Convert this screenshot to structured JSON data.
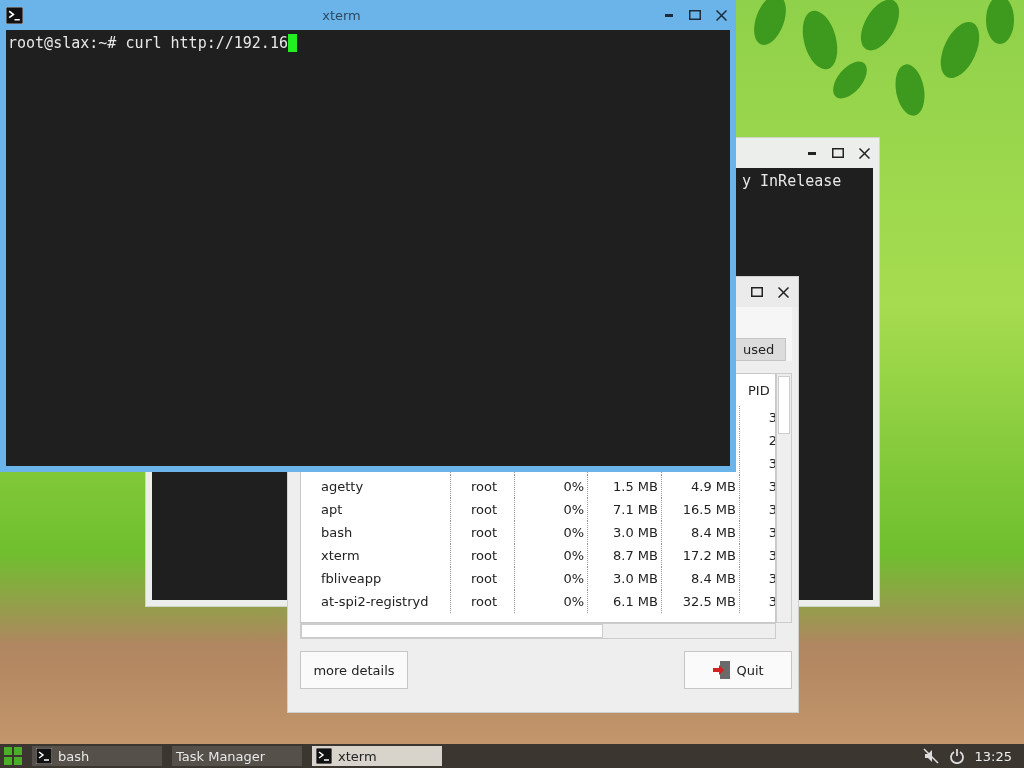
{
  "background_terminal": {
    "text": "y InRelease"
  },
  "task_manager": {
    "memory_label": "used",
    "table": {
      "pid_header": "PID",
      "rows": [
        {
          "pid": "3"
        },
        {
          "pid": "2"
        },
        {
          "pid": "3"
        },
        {
          "name": "agetty",
          "user": "root",
          "cpu": "0%",
          "rss": "1.5 MB",
          "vsz": "4.9 MB",
          "pid": "3"
        },
        {
          "name": "apt",
          "user": "root",
          "cpu": "0%",
          "rss": "7.1 MB",
          "vsz": "16.5 MB",
          "pid": "3"
        },
        {
          "name": "bash",
          "user": "root",
          "cpu": "0%",
          "rss": "3.0 MB",
          "vsz": "8.4 MB",
          "pid": "3"
        },
        {
          "name": "xterm",
          "user": "root",
          "cpu": "0%",
          "rss": "8.7 MB",
          "vsz": "17.2 MB",
          "pid": "3"
        },
        {
          "name": "fbliveapp",
          "user": "root",
          "cpu": "0%",
          "rss": "3.0 MB",
          "vsz": "8.4 MB",
          "pid": "3"
        },
        {
          "name": "at-spi2-registryd",
          "user": "root",
          "cpu": "0%",
          "rss": "6.1 MB",
          "vsz": "32.5 MB",
          "pid": "3"
        }
      ]
    },
    "buttons": [
      {
        "label": "more details",
        "kind": "text"
      },
      {
        "label": "Quit",
        "kind": "quit"
      }
    ]
  },
  "xterm": {
    "title": "xterm",
    "line": "root@slax:~# curl http://192.16"
  },
  "taskbar": {
    "tasks": [
      {
        "label": "bash",
        "kind": "terminal",
        "selected": false
      },
      {
        "label": "Task Manager",
        "kind": "plain",
        "selected": false
      },
      {
        "label": "xterm",
        "kind": "terminal",
        "selected": true
      }
    ],
    "clock": "13:25"
  }
}
